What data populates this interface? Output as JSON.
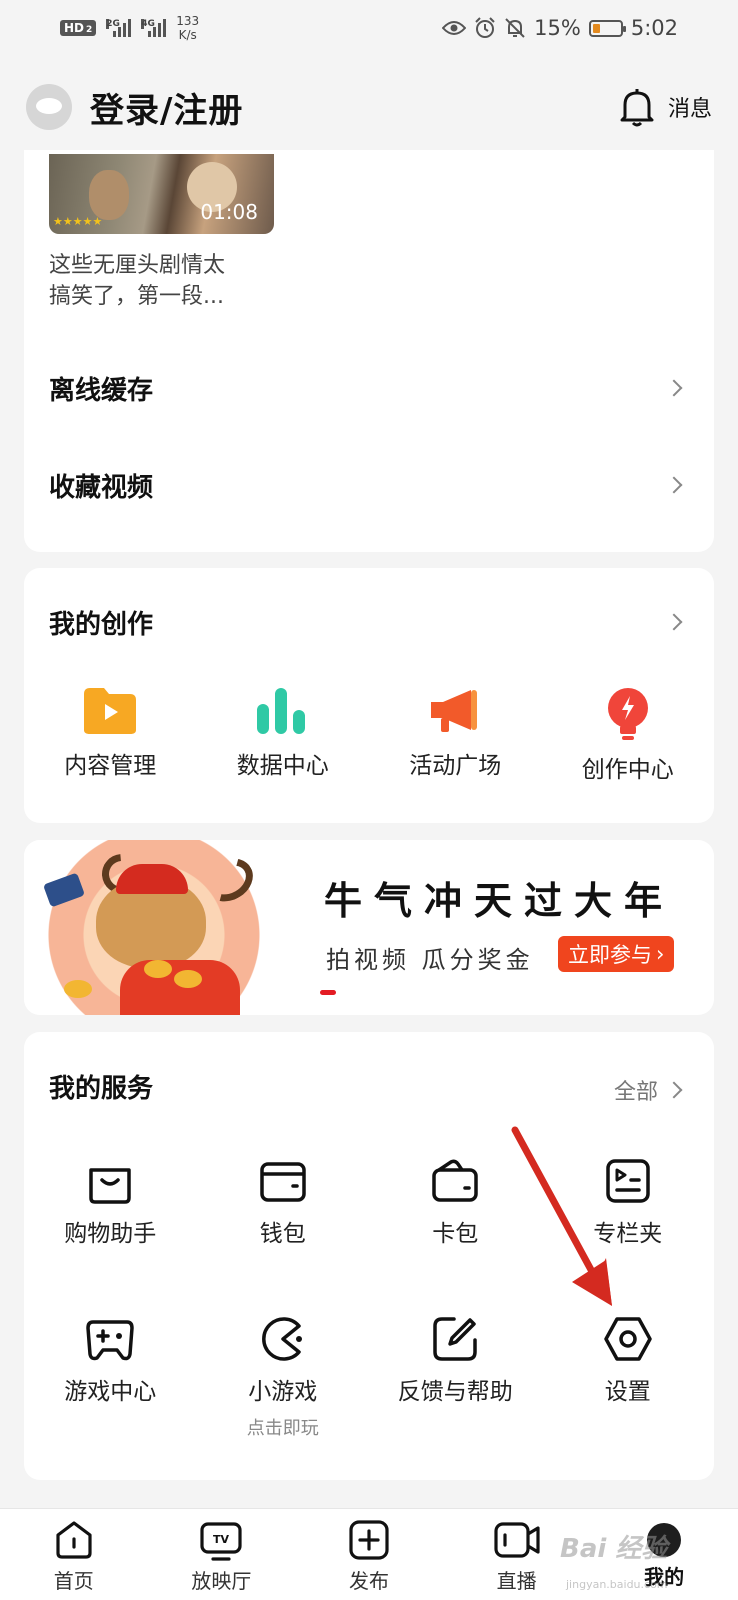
{
  "status_bar": {
    "hd": "HD",
    "hd_sub": "2",
    "sig1_tag": "2G",
    "sig2_tag": "4G",
    "speed_value": "133",
    "speed_unit": "K/s",
    "battery": "15%",
    "time": "5:02",
    "battery_color": "#e38a1f"
  },
  "header": {
    "login_label": "登录/注册",
    "message_label": "消息"
  },
  "history_card": {
    "video_duration": "01:08",
    "video_caption_line1": "这些无厘头剧情太",
    "video_caption_line2": "搞笑了，第一段...",
    "offline_cache": "离线缓存",
    "favorite_videos": "收藏视频"
  },
  "creation": {
    "title": "我的创作",
    "items": [
      {
        "label": "内容管理",
        "icon": "content-manage-icon"
      },
      {
        "label": "数据中心",
        "icon": "data-center-icon"
      },
      {
        "label": "活动广场",
        "icon": "activity-plaza-icon"
      },
      {
        "label": "创作中心",
        "icon": "creator-center-icon"
      }
    ]
  },
  "banner": {
    "title": "牛气冲天过大年",
    "subtitle": "拍视频  瓜分奖金",
    "button": "立即参与",
    "accent_color": "#f0451e"
  },
  "services": {
    "title": "我的服务",
    "all_label": "全部",
    "items": [
      {
        "label": "购物助手",
        "icon": "shopping-bag-icon"
      },
      {
        "label": "钱包",
        "icon": "wallet-icon"
      },
      {
        "label": "卡包",
        "icon": "card-holder-icon"
      },
      {
        "label": "专栏夹",
        "icon": "column-folder-icon"
      },
      {
        "label": "游戏中心",
        "icon": "gamepad-icon"
      },
      {
        "label": "小游戏",
        "sub": "点击即玩",
        "icon": "mini-game-icon"
      },
      {
        "label": "反馈与帮助",
        "icon": "feedback-edit-icon"
      },
      {
        "label": "设置",
        "icon": "settings-hex-icon"
      }
    ]
  },
  "tabbar": {
    "tabs": [
      {
        "label": "首页",
        "icon": "home-icon"
      },
      {
        "label": "放映厅",
        "icon": "tv-icon"
      },
      {
        "label": "发布",
        "icon": "publish-plus-icon"
      },
      {
        "label": "直播",
        "icon": "live-camera-icon"
      },
      {
        "label": "我的",
        "icon": "me-avatar-icon",
        "active": true
      }
    ]
  },
  "watermark": {
    "text": "Bai 经验",
    "url_text": "jingyan.baidu.com"
  }
}
